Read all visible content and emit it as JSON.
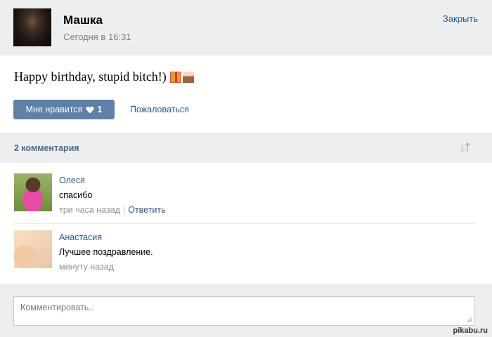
{
  "header": {
    "author": "Машка",
    "time": "Сегодня в 16:31",
    "close_label": "Закрыть"
  },
  "post": {
    "text": "Happy birthday, stupid bitch!)",
    "emojis": [
      "gift-icon",
      "cake-icon"
    ],
    "like_label": "Мне нравится",
    "like_count": "1",
    "report_label": "Пожаловаться"
  },
  "comments_bar": {
    "count_label": "2 комментария"
  },
  "comments": [
    {
      "name": "Олеся",
      "text": "спасибо",
      "time": "три часа назад",
      "separator": "|",
      "reply_label": "Ответить"
    },
    {
      "name": "Анастасия",
      "text": "Лучшее поздравление.",
      "time": "минуту назад"
    }
  ],
  "comment_input": {
    "placeholder": "Комментировать.."
  },
  "watermark": "pikabu.ru",
  "colors": {
    "link": "#2a5885",
    "button": "#5e81a8",
    "background": "#edeef0"
  }
}
